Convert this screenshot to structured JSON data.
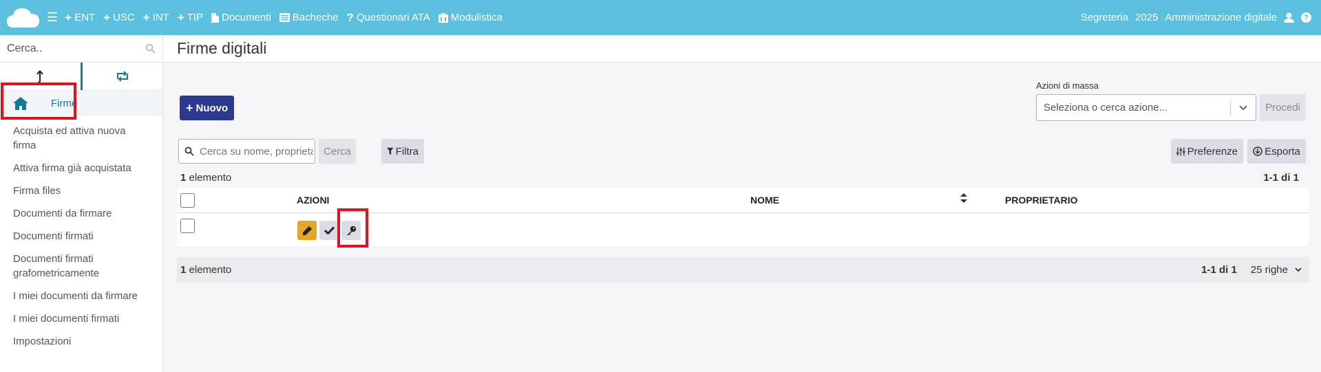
{
  "topbar": {
    "nav": [
      {
        "icon": "plus-icon",
        "label": "ENT"
      },
      {
        "icon": "plus-icon",
        "label": "USC"
      },
      {
        "icon": "plus-icon",
        "label": "INT"
      },
      {
        "icon": "plus-icon",
        "label": "TIP"
      },
      {
        "icon": "document-icon",
        "label": "Documenti"
      },
      {
        "icon": "board-icon",
        "label": "Bacheche"
      },
      {
        "icon": "question-icon",
        "label": "Questionari ATA"
      },
      {
        "icon": "forms-icon",
        "label": "Modulistica"
      }
    ],
    "office": "Segreteria",
    "year": "2025",
    "admin": "Amministrazione digitale",
    "help_glyph": "?"
  },
  "sidebar": {
    "search_placeholder": "Cerca..",
    "home_label": "Firme",
    "items": [
      "Acquista ed attiva nuova firma",
      "Attiva firma già acquistata",
      "Firma files",
      "Documenti da firmare",
      "Documenti firmati",
      "Documenti firmati grafometricamente",
      "I miei documenti da firmare",
      "I miei documenti firmati",
      "Impostazioni"
    ]
  },
  "main": {
    "title": "Firme digitali",
    "new_button": "Nuovo",
    "mass_actions_label": "Azioni di massa",
    "mass_actions_placeholder": "Seleziona o cerca azione...",
    "procedi_button": "Procedi",
    "search_placeholder": "Cerca su nome, proprieta",
    "search_button": "Cerca",
    "filter_button": "Filtra",
    "preferences_button": "Preferenze",
    "export_button": "Esporta",
    "count_number": "1",
    "count_label": "elemento",
    "range": "1-1 di 1",
    "rows_per_page": "25 righe"
  },
  "table": {
    "columns": [
      "AZIONI",
      "NOME",
      "PROPRIETARIO"
    ],
    "rows": [
      {
        "nome": "",
        "proprietario": "",
        "actions": [
          "edit-icon",
          "check-icon",
          "key-icon"
        ]
      }
    ]
  },
  "colors": {
    "topbar": "#5bc0de",
    "primary": "#2b3990",
    "accent": "#137b96",
    "edit": "#e0a826",
    "highlight": "#e0141e"
  }
}
